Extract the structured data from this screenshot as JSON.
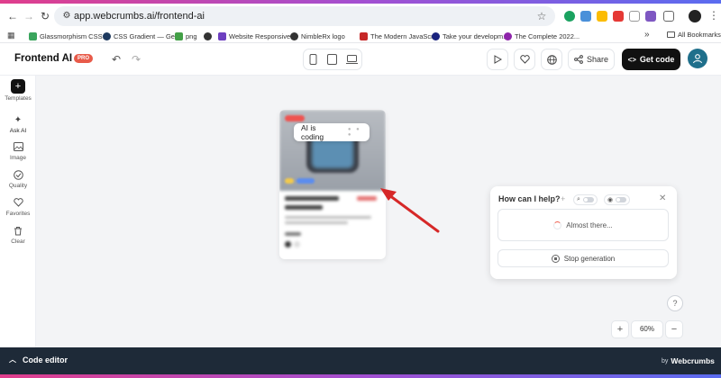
{
  "browser": {
    "url": "app.webcrumbs.ai/frontend-ai",
    "bookmarks": [
      {
        "label": "Glassmorphism CSS...",
        "color": "#3aa55d"
      },
      {
        "label": "CSS Gradient — Ge...",
        "color": "#1e3a5f"
      },
      {
        "label": "png",
        "color": "#43a047"
      },
      {
        "label": "",
        "color": "#333333"
      },
      {
        "label": "Website Responsive...",
        "color": "#6d3fc0"
      },
      {
        "label": "NimbleRx logo",
        "color": "#333333"
      },
      {
        "label": "The Modern JavaScr...",
        "color": "#c62828"
      },
      {
        "label": "Take your developm...",
        "color": "#1a237e"
      },
      {
        "label": "The Complete 2022...",
        "color": "#8e24aa"
      }
    ],
    "all_bookmarks": "All Bookmarks"
  },
  "header": {
    "brand": "Frontend AI",
    "pro_badge": "PRO",
    "share_label": "Share",
    "get_code_label": "Get code"
  },
  "sidebar": {
    "items": [
      {
        "label": "Templates",
        "icon": "plus-icon"
      },
      {
        "label": "Ask AI",
        "icon": "sparkle-icon"
      },
      {
        "label": "Image",
        "icon": "image-icon"
      },
      {
        "label": "Quality",
        "icon": "check-circle-icon"
      },
      {
        "label": "Favorites",
        "icon": "heart-icon"
      },
      {
        "label": "Clear",
        "icon": "trash-icon"
      }
    ]
  },
  "canvas": {
    "status_pill": "AI is coding"
  },
  "help_panel": {
    "title": "How can I help?",
    "status": "Almost there...",
    "stop_label": "Stop generation"
  },
  "zoom": {
    "value": "60%"
  },
  "footer": {
    "code_editor_label": "Code editor",
    "by_label": "by",
    "brand": "Webcrumbs"
  },
  "colors": {
    "accent": "#f05a4a",
    "footer_bg": "#1e2a38",
    "arrow": "#d62828"
  }
}
